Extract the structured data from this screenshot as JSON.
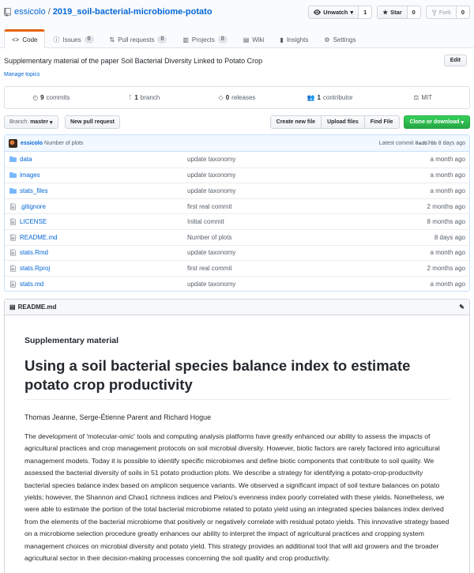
{
  "repo": {
    "owner": "essicolo",
    "separator": "/",
    "name": "2019_soil-bacterial-microbiome-potato"
  },
  "actions": [
    {
      "label": "Unwatch",
      "count": "1",
      "icon": "eye-icon"
    },
    {
      "label": "Star",
      "count": "0",
      "icon": "star-icon"
    },
    {
      "label": "Fork",
      "count": "0",
      "icon": "fork-icon"
    }
  ],
  "tabs": [
    {
      "label": "Code",
      "icon": "code-icon"
    },
    {
      "label": "Issues",
      "count": "0",
      "icon": "issue-icon"
    },
    {
      "label": "Pull requests",
      "count": "0",
      "icon": "pull-request-icon"
    },
    {
      "label": "Projects",
      "count": "0",
      "icon": "project-icon"
    },
    {
      "label": "Wiki",
      "icon": "book-icon"
    },
    {
      "label": "Insights",
      "icon": "graph-icon"
    },
    {
      "label": "Settings",
      "icon": "gear-icon"
    }
  ],
  "description": "Supplementary material of the paper Soil Bacterial Diversity Linked to Potato Crop",
  "manage_topics": "Manage topics",
  "edit_label": "Edit",
  "summary": [
    {
      "num": "9",
      "label": "commits",
      "icon": "history-icon"
    },
    {
      "num": "1",
      "label": "branch",
      "icon": "branch-icon"
    },
    {
      "num": "0",
      "label": "releases",
      "icon": "tag-icon"
    },
    {
      "num": "1",
      "label": "contributor",
      "icon": "people-icon"
    },
    {
      "num": "",
      "label": "MIT",
      "icon": "law-icon"
    }
  ],
  "branch": {
    "prefix": "Branch:",
    "name": "master"
  },
  "new_pr": "New pull request",
  "file_buttons": [
    "Create new file",
    "Upload files",
    "Find File"
  ],
  "clone_label": "Clone or download",
  "commit": {
    "author": "essicolo",
    "message": "Number of plots",
    "latest": "Latest commit",
    "sha": "8adb76b",
    "age": "8 days ago"
  },
  "files": [
    {
      "name": "data",
      "type": "dir",
      "message": "update taxonomy",
      "age": "a month ago"
    },
    {
      "name": "images",
      "type": "dir",
      "message": "update taxonomy",
      "age": "a month ago"
    },
    {
      "name": "stats_files",
      "type": "dir",
      "message": "update taxonomy",
      "age": "a month ago"
    },
    {
      "name": ".gitignore",
      "type": "file",
      "message": "first real commit",
      "age": "2 months ago"
    },
    {
      "name": "LICENSE",
      "type": "file",
      "message": "Initial commit",
      "age": "8 months ago"
    },
    {
      "name": "README.md",
      "type": "file",
      "message": "Number of plots",
      "age": "8 days ago"
    },
    {
      "name": "stats.Rmd",
      "type": "file",
      "message": "update taxonomy",
      "age": "a month ago"
    },
    {
      "name": "stats.Rproj",
      "type": "file",
      "message": "first real commit",
      "age": "2 months ago"
    },
    {
      "name": "stats.md",
      "type": "file",
      "message": "update taxonomy",
      "age": "a month ago"
    }
  ],
  "readme": {
    "filename": "README.md",
    "subtitle": "Supplementary material",
    "title": "Using a soil bacterial species balance index to estimate potato crop productivity",
    "authors": "Thomas Jeanne, Serge-Étienne Parent and Richard Hogue",
    "abstract": "The development of 'molecular-omic' tools and computing analysis platforms have greatly enhanced our ability to assess the impacts of agricultural practices and crop management protocols on soil microbial diversity. However, biotic factors are rarely factored into agricultural management models. Today it is possible to identify specific microbiomes and define biotic components that contribute to soil quality. We assessed the bacterial diversity of soils in 51 potato production plots. We describe a strategy for identifying a potato-crop-productivity bacterial species balance index based on amplicon sequence variants. We observed a significant impact of soil texture balances on potato yields; however, the Shannon and Chao1 richness indices and Pielou's evenness index poorly correlated with these yields. Nonetheless, we were able to estimate the portion of the total bacterial microbiome related to potato yield using an integrated species balances index derived from the elements of the bacterial microbiome that positively or negatively correlate with residual potato yields. This innovative strategy based on a microbiome selection procedure greatly enhances our ability to interpret the impact of agricultural practices and cropping system management choices on microbial diversity and potato yield. This strategy provides an additional tool that will aid growers and the broader agricultural sector in their decision-making processes concerning the soil quality and crop productivity."
  }
}
